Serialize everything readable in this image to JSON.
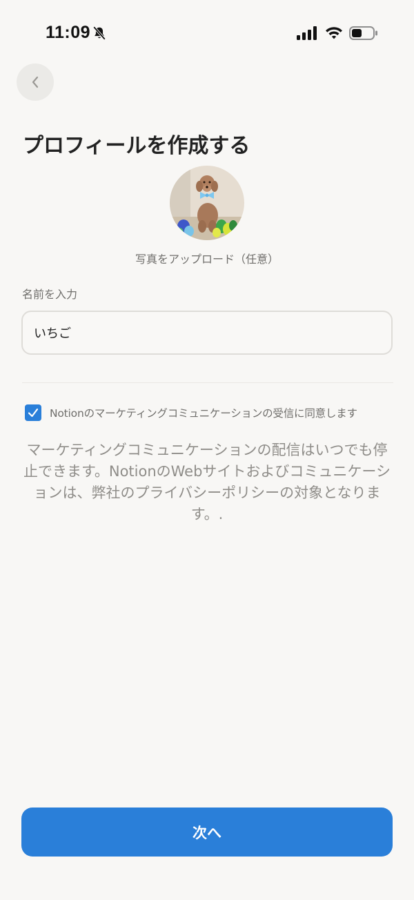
{
  "status_bar": {
    "time": "11:09"
  },
  "icons": {
    "bell": "bell-slash-icon",
    "signal": "cellular-signal-icon",
    "wifi": "wifi-icon",
    "battery": "battery-icon",
    "back": "chevron-left-icon",
    "check": "checkmark-icon"
  },
  "header": {
    "title": "プロフィールを作成する"
  },
  "profile": {
    "upload_label": "写真をアップロード（任意）"
  },
  "name_field": {
    "label": "名前を入力",
    "value": "いちご"
  },
  "consent": {
    "checked": true,
    "label": "Notionのマーケティングコミュニケーションの受信に同意します"
  },
  "policy": {
    "text_before": "マーケティングコミュニケーションの配信はいつでも停止できます。NotionのWebサイトおよびコミュニケーションは、弊社の",
    "link": "プライバシーポリシー",
    "text_after": "の対象となります。."
  },
  "footer": {
    "next_label": "次へ"
  },
  "colors": {
    "accent": "#2a7fd9",
    "background": "#f8f7f5",
    "muted_text": "#8f8d89"
  }
}
